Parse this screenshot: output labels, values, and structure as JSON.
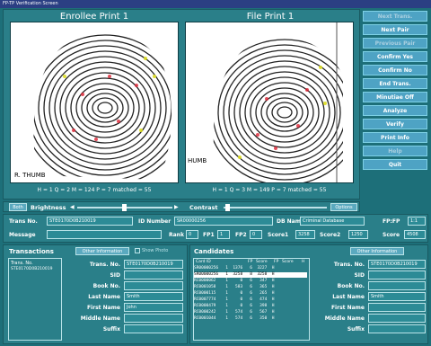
{
  "window": {
    "title": "FP-TP Verification Screen"
  },
  "enrollee": {
    "title": "Enrollee Print 1",
    "label": "R. THUMB",
    "stats": "H = 1  Q = 2  M = 124  P = 7  matched = 55"
  },
  "file": {
    "title": "File Print 1",
    "label": "HUMB",
    "stats": "H = 1  Q = 3  M = 149  P = 7  matched = 55"
  },
  "sidebar": [
    "Next Trans.",
    "Next Pair",
    "Previous Pair",
    "Confirm Yes",
    "Confirm No",
    "End Trans.",
    "Minutiae Off",
    "Analyze",
    "Verify",
    "Print Info",
    "Help",
    "Quit"
  ],
  "controls": {
    "both": "Both",
    "brightness": "Brightness",
    "contrast": "Contrast",
    "options": "Options"
  },
  "info": {
    "trans_label": "Trans No.",
    "trans_value": "STE0170D0B210019",
    "id_label": "ID Number",
    "id_value": "SR00000256",
    "db_label": "DB Name",
    "db_value": "Criminal Database",
    "fpfp_label": "FP:FP",
    "fpfp_value": "1:1",
    "message_label": "Message",
    "rank_label": "Rank",
    "rank_value": "0",
    "fp1_label": "FP1",
    "fp1_value": "1",
    "fp2_label": "FP2",
    "fp2_value": "0",
    "score1_label": "Score1",
    "score1_value": "3258",
    "score2_label": "Score2",
    "score2_value": "1250",
    "score_label": "Score",
    "score_value": "4508"
  },
  "transactions": {
    "title": "Transactions",
    "other_info": "Other Information",
    "show_photo": "Show Photo",
    "list_header": "Trans. No.",
    "list_items": [
      "STE0170D0B210019"
    ],
    "fields": [
      {
        "label": "Trans. No.",
        "value": "STE0170D0B210019"
      },
      {
        "label": "SID",
        "value": ""
      },
      {
        "label": "Book No.",
        "value": ""
      },
      {
        "label": "Last Name",
        "value": "Smith"
      },
      {
        "label": "First Name",
        "value": "John"
      },
      {
        "label": "Middle Name",
        "value": ""
      },
      {
        "label": "Suffix",
        "value": ""
      }
    ]
  },
  "candidates": {
    "title": "Candidates",
    "other_info": "Other Information",
    "headers": [
      "Card ID",
      "FP",
      "Score",
      "FP",
      "Score",
      "H"
    ],
    "rows": [
      "SR00000256   1  1376   6  3227  H",
      "SR00000256   1  3258   8  3258  H",
      "RC0000062    1     0   6   347  H",
      "RC0001058    1   583   6   365  H",
      "RC0000115    1     0   6   265  H",
      "RC0007774    1     0   6   474  H",
      "RC0000479    1     0   6   398  H",
      "RC0000242    1   574   6   567  H",
      "RC0001044    1   574   6   350  H"
    ],
    "fields": [
      {
        "label": "Trans. No.",
        "value": "STE0170D0B210019"
      },
      {
        "label": "SID",
        "value": ""
      },
      {
        "label": "Book No.",
        "value": ""
      },
      {
        "label": "Last Name",
        "value": "Smith"
      },
      {
        "label": "First Name",
        "value": ""
      },
      {
        "label": "Middle Name",
        "value": ""
      },
      {
        "label": "Suffix",
        "value": ""
      }
    ]
  }
}
